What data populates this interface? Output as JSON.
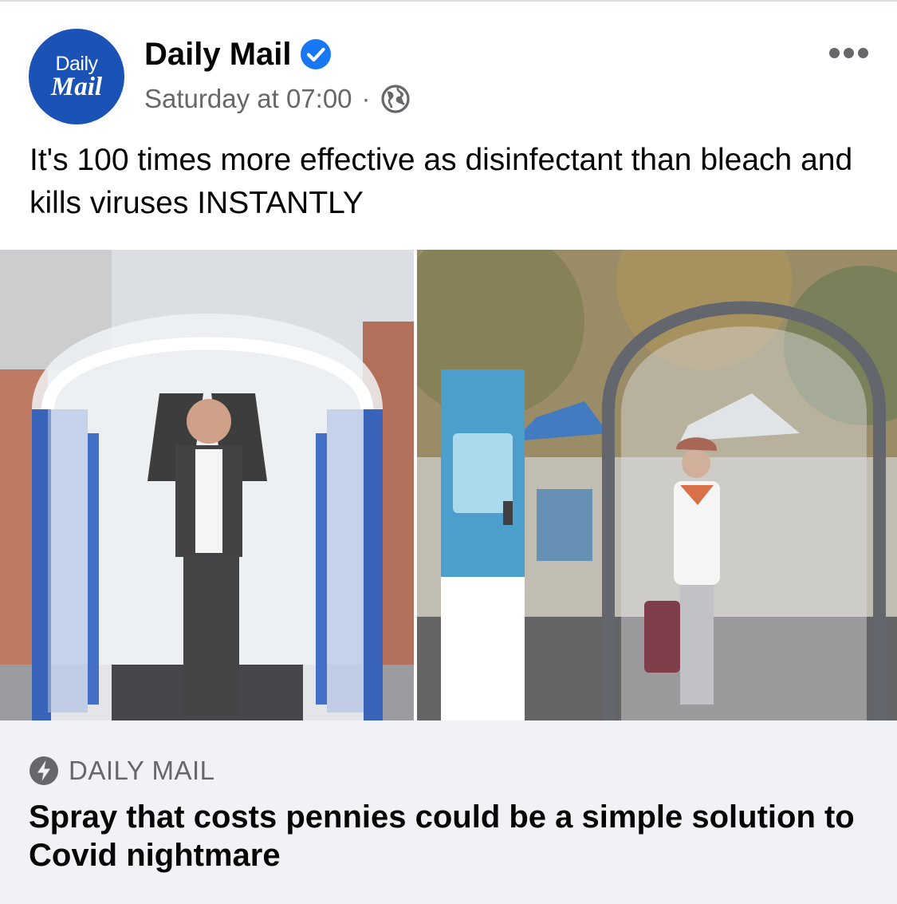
{
  "post": {
    "page_name": "Daily Mail",
    "verified": true,
    "avatar": {
      "line1": "Daily",
      "line2": "Mail",
      "color": "#1a52b6"
    },
    "timestamp": "Saturday at 07:00",
    "separator": "·",
    "audience_icon": "globe-icon",
    "caption": "It's 100 times more effective as disinfectant than bleach and kills viruses INSTANTLY"
  },
  "link_preview": {
    "source_icon": "instant-article-bolt-icon",
    "source": "DAILY MAIL",
    "headline": "Spray that costs pennies could be a simple solution to Covid nightmare"
  },
  "colors": {
    "brand_blue": "#1a52b6",
    "verified_blue": "#1877f2",
    "muted": "#65676b",
    "card_bg": "#f0f2f5"
  }
}
